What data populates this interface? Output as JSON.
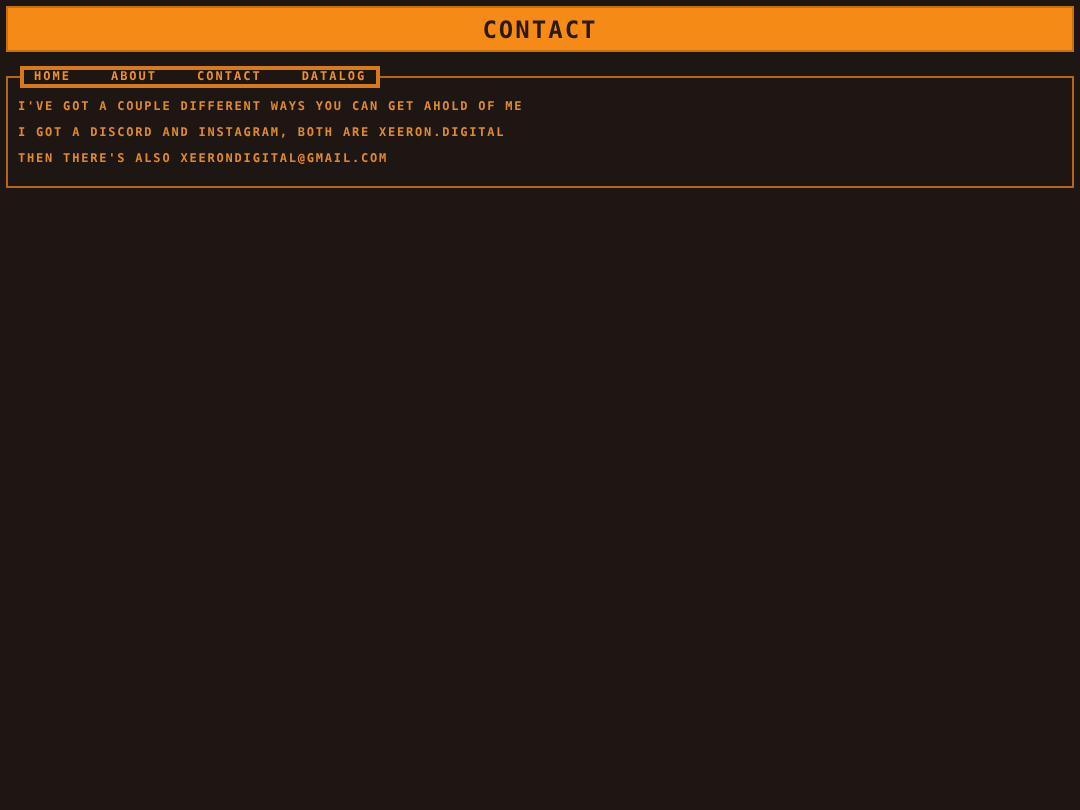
{
  "header": {
    "title": "CONTACT"
  },
  "nav": [
    "HOME",
    "ABOUT",
    "CONTACT",
    "DATALOG"
  ],
  "paragraphs": [
    "I'VE GOT A COUPLE DIFFERENT WAYS YOU CAN GET AHOLD OF ME",
    "I GOT A DISCORD AND INSTAGRAM, BOTH ARE XEERON.DIGITAL",
    "THEN THERE'S ALSO XEERONDIGITAL@GMAIL.COM"
  ]
}
